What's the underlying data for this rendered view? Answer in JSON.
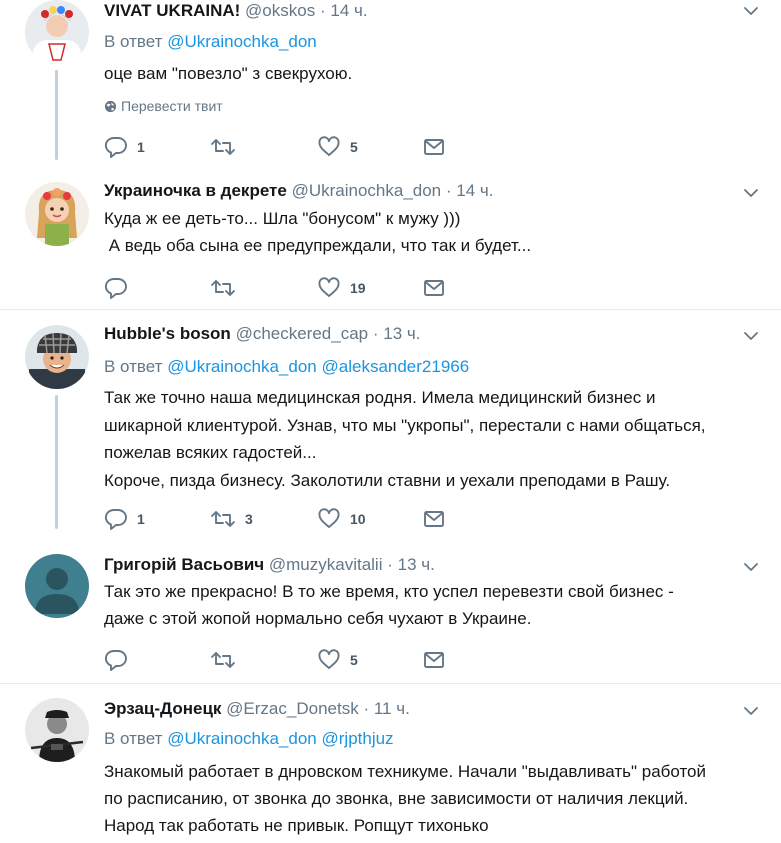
{
  "tweets": [
    {
      "name": "VIVAT UKRAINA!",
      "handle": "@okskos",
      "time": "14 ч.",
      "reply_prefix": "В ответ",
      "reply_to": [
        "@Ukrainochka_don"
      ],
      "text": "оце вам \"повезло\" з свекрухою.",
      "translate": "Перевести твит",
      "replies": "1",
      "retweets": "",
      "likes": "5"
    },
    {
      "name": "Украиночка в декрете",
      "handle": "@Ukrainochka_don",
      "time": "14 ч.",
      "text_lines": [
        "Куда ж ее деть-то... Шла \"бонусом\" к мужу )))",
        " А ведь оба сына ее предупреждали, что так и будет..."
      ],
      "replies": "",
      "retweets": "",
      "likes": "19"
    },
    {
      "name": "Hubble's boson",
      "handle": "@checkered_cap",
      "time": "13 ч.",
      "reply_prefix": "В ответ",
      "reply_to": [
        "@Ukrainochka_don",
        "@aleksander21966"
      ],
      "text_lines": [
        "Так же точно наша медицинская родня. Имела медицинский бизнес и",
        "шикарной клиентурой. Узнав, что мы \"укропы\", перестали с нами общаться,",
        "пожелав всяких гадостей...",
        "Короче, пизда бизнесу. Заколотили ставни и уехали преподами в Рашу."
      ],
      "replies": "1",
      "retweets": "3",
      "likes": "10"
    },
    {
      "name": "Григорій Васьович",
      "handle": "@muzykavitalii",
      "time": "13 ч.",
      "text_lines": [
        "Так это же прекрасно! В то же время, кто успел перевезти свой бизнес -",
        "даже с этой жопой нормально себя чухают в Украине."
      ],
      "replies": "",
      "retweets": "",
      "likes": "5"
    },
    {
      "name": "Эрзац-Донецк",
      "handle": "@Erzac_Donetsk",
      "time": "11 ч.",
      "reply_prefix": "В ответ",
      "reply_to": [
        "@Ukrainochka_don",
        "@rjpthjuz"
      ],
      "text_lines": [
        "Знакомый работает в днровском техникуме. Начали \"выдавливать\" работой",
        "по расписанию, от звонка до звонка, вне зависимости от наличия лекций.",
        "Народ так работать не привык. Ропщут тихонько"
      ]
    }
  ],
  "separator": "·",
  "icons": {
    "reply": "reply-icon",
    "retweet": "retweet-icon",
    "like": "heart-icon",
    "dm": "envelope-icon",
    "more": "chevron-down-icon",
    "globe": "globe-icon"
  },
  "colors": {
    "text": "#14171a",
    "secondary": "#657786",
    "link": "#1b95e0",
    "action_icon": "#657786",
    "divider": "#e6ecf0",
    "thread_line": "#c4d0d9"
  }
}
